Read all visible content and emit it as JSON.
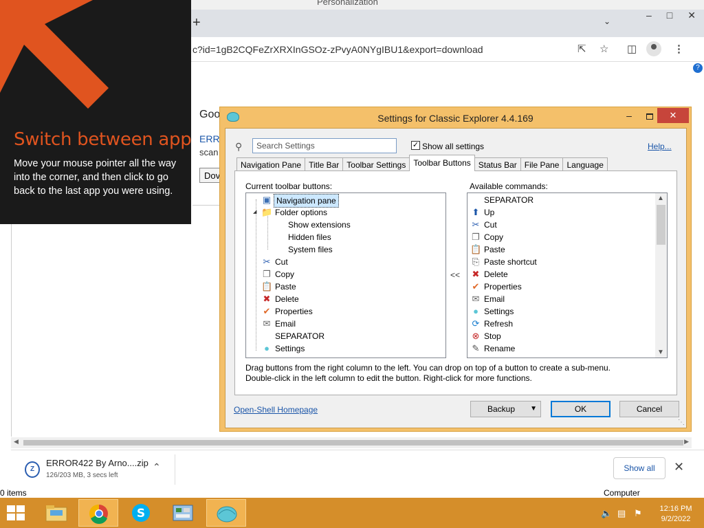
{
  "background_window": {
    "title": "Personalization",
    "url": "c?id=1gB2CQFeZrXRXInGSOz-zPvyA0NYgIBU1&export=download",
    "page": {
      "heading_fragment": "Goo",
      "error_link_fragment": "ERRO",
      "scan_text_fragment": "scan",
      "download_button_fragment": "Dov"
    },
    "download_bar": {
      "filename": "ERROR422 By Arno....zip",
      "status": "126/203 MB, 3 secs left",
      "show_all": "Show all"
    },
    "explorer_status_items": "0 items",
    "explorer_status_computer": "Computer"
  },
  "charm_tip": {
    "title": "Switch between apps",
    "body": "Move your mouse pointer all the way into the corner, and then click to go back to the last app you were using.",
    "accent_color": "#e0541f"
  },
  "settings_dialog": {
    "title": "Settings for Classic Explorer 4.4.169",
    "search_placeholder": "Search Settings",
    "show_all_settings_label": "Show all settings",
    "show_all_checked": true,
    "help_link": "Help...",
    "tabs": [
      {
        "label": "Navigation Pane",
        "active": false
      },
      {
        "label": "Title Bar",
        "active": false
      },
      {
        "label": "Toolbar Settings",
        "active": false
      },
      {
        "label": "Toolbar Buttons",
        "active": true
      },
      {
        "label": "Status Bar",
        "active": false
      },
      {
        "label": "File Pane",
        "active": false
      },
      {
        "label": "Language",
        "active": false
      }
    ],
    "current_buttons_label": "Current toolbar buttons:",
    "available_commands_label": "Available commands:",
    "move_arrow": "<<",
    "current_buttons": [
      {
        "label": "Navigation pane",
        "icon": "navigation-pane-icon",
        "indent": 0,
        "selected": true
      },
      {
        "label": "Folder options",
        "icon": "folder-options-icon",
        "indent": 0,
        "expander": true
      },
      {
        "label": "Show extensions",
        "icon": "",
        "indent": 1
      },
      {
        "label": "Hidden files",
        "icon": "",
        "indent": 1
      },
      {
        "label": "System files",
        "icon": "",
        "indent": 1
      },
      {
        "label": "Cut",
        "icon": "scissors-icon",
        "indent": 0
      },
      {
        "label": "Copy",
        "icon": "copy-icon",
        "indent": 0
      },
      {
        "label": "Paste",
        "icon": "paste-icon",
        "indent": 0
      },
      {
        "label": "Delete",
        "icon": "delete-icon",
        "indent": 0
      },
      {
        "label": "Properties",
        "icon": "properties-icon",
        "indent": 0
      },
      {
        "label": "Email",
        "icon": "email-icon",
        "indent": 0
      },
      {
        "label": "SEPARATOR",
        "icon": "",
        "indent": 0
      },
      {
        "label": "Settings",
        "icon": "settings-shell-icon",
        "indent": 0
      }
    ],
    "available_commands": [
      {
        "label": "SEPARATOR",
        "icon": ""
      },
      {
        "label": "Up",
        "icon": "up-arrow-icon"
      },
      {
        "label": "Cut",
        "icon": "scissors-icon"
      },
      {
        "label": "Copy",
        "icon": "copy-icon"
      },
      {
        "label": "Paste",
        "icon": "paste-icon"
      },
      {
        "label": "Paste shortcut",
        "icon": "paste-shortcut-icon"
      },
      {
        "label": "Delete",
        "icon": "delete-icon"
      },
      {
        "label": "Properties",
        "icon": "properties-icon"
      },
      {
        "label": "Email",
        "icon": "email-icon"
      },
      {
        "label": "Settings",
        "icon": "settings-shell-icon"
      },
      {
        "label": "Refresh",
        "icon": "refresh-icon"
      },
      {
        "label": "Stop",
        "icon": "stop-icon"
      },
      {
        "label": "Rename",
        "icon": "rename-icon"
      }
    ],
    "help_text_line1": "Drag buttons from the right column to the left. You can drop on top of a button to create a sub-menu.",
    "help_text_line2": "Double-click in the left column to edit the button. Right-click for more functions.",
    "homepage_link": "Open-Shell Homepage",
    "backup_button": "Backup",
    "ok_button": "OK",
    "cancel_button": "Cancel"
  },
  "taskbar": {
    "time": "12:16 PM",
    "date": "9/2/2022",
    "color": "#d58e2a",
    "apps": [
      "file-explorer-icon",
      "chrome-icon",
      "skype-icon",
      "control-panel-icon",
      "classic-shell-icon"
    ]
  }
}
